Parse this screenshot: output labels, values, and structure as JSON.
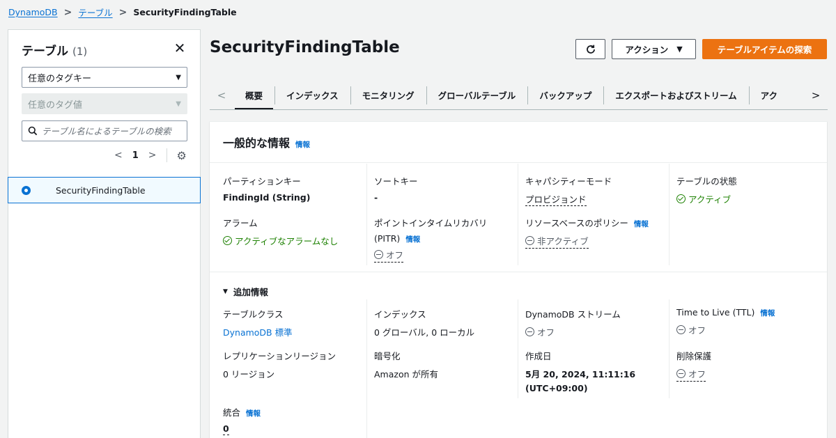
{
  "breadcrumb": {
    "items": [
      "DynamoDB",
      "テーブル"
    ],
    "current": "SecurityFindingTable"
  },
  "sidebar": {
    "title": "テーブル",
    "count": "(1)",
    "tag_key_select": "任意のタグキー",
    "tag_value_select": "任意のタグ値",
    "search_placeholder": "テーブル名によるテーブルの検索",
    "page_number": "1",
    "tables": [
      "SecurityFindingTable"
    ]
  },
  "header": {
    "title": "SecurityFindingTable",
    "action_label": "アクション",
    "primary_label": "テーブルアイテムの探索"
  },
  "tabs": [
    "概要",
    "インデックス",
    "モニタリング",
    "グローバルテーブル",
    "バックアップ",
    "エクスポートおよびストリーム",
    "アク"
  ],
  "general": {
    "title": "一般的な情報",
    "info": "情報",
    "partition_key_label": "パーティションキー",
    "partition_key_value": "FindingId (String)",
    "sort_key_label": "ソートキー",
    "sort_key_value": "-",
    "capacity_label": "キャパシティーモード",
    "capacity_value": "プロビジョンド",
    "status_label": "テーブルの状態",
    "status_value": "アクティブ",
    "alarm_label": "アラーム",
    "alarm_value": "アクティブなアラームなし",
    "pitr_label": "ポイントインタイムリカバリ",
    "pitr_label2": "(PITR)",
    "pitr_info": "情報",
    "pitr_value": "オフ",
    "policy_label": "リソースベースのポリシー",
    "policy_info": "情報",
    "policy_value": "非アクティブ"
  },
  "additional": {
    "title": "追加情報",
    "class_label": "テーブルクラス",
    "class_value": "DynamoDB 標準",
    "index_label": "インデックス",
    "index_value": "0 グローバル, 0 ローカル",
    "stream_label": "DynamoDB ストリーム",
    "stream_value": "オフ",
    "ttl_label": "Time to Live (TTL)",
    "ttl_info": "情報",
    "ttl_value": "オフ",
    "replication_label": "レプリケーションリージョン",
    "replication_value": "0 リージョン",
    "encryption_label": "暗号化",
    "encryption_value": "Amazon が所有",
    "created_label": "作成日",
    "created_value_1": "5月 20, 2024, 11:11:16",
    "created_value_2": "(UTC+09:00)",
    "deletion_label": "削除保護",
    "deletion_value": "オフ",
    "integration_label": "統合",
    "integration_info": "情報",
    "integration_value": "0"
  },
  "colors": {
    "accent": "#0972d3",
    "primary": "#ec7211",
    "success": "#1d8102"
  }
}
